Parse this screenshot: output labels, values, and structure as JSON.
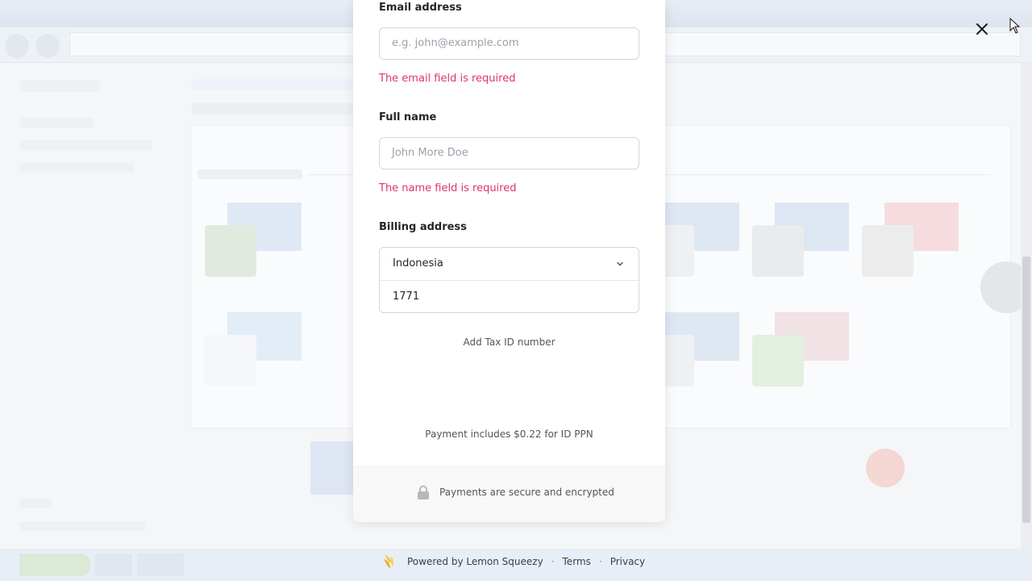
{
  "form": {
    "email": {
      "label": "Email address",
      "placeholder": "e.g. john@example.com",
      "error": "The email field is required"
    },
    "name": {
      "label": "Full name",
      "placeholder": "John More Doe",
      "error": "The name field is required"
    },
    "billing": {
      "label": "Billing address",
      "country": "Indonesia",
      "postal_code": "1771"
    },
    "add_tax_id": "Add Tax ID number",
    "payment_note": "Payment includes $0.22 for ID PPN",
    "secure_note": "Payments are secure and encrypted"
  },
  "footer": {
    "powered_by": "Powered by Lemon Squeezy",
    "separator": "·",
    "terms": "Terms",
    "privacy": "Privacy"
  },
  "icons": {
    "close": "close-icon",
    "chevron": "chevron-down-icon",
    "lock": "lock-icon",
    "logo": "lemon-squeezy-logo-icon"
  },
  "colors": {
    "error": "#e0336a",
    "text": "#22262b",
    "muted": "#4f565f",
    "brand_logo": "#f5c531"
  }
}
